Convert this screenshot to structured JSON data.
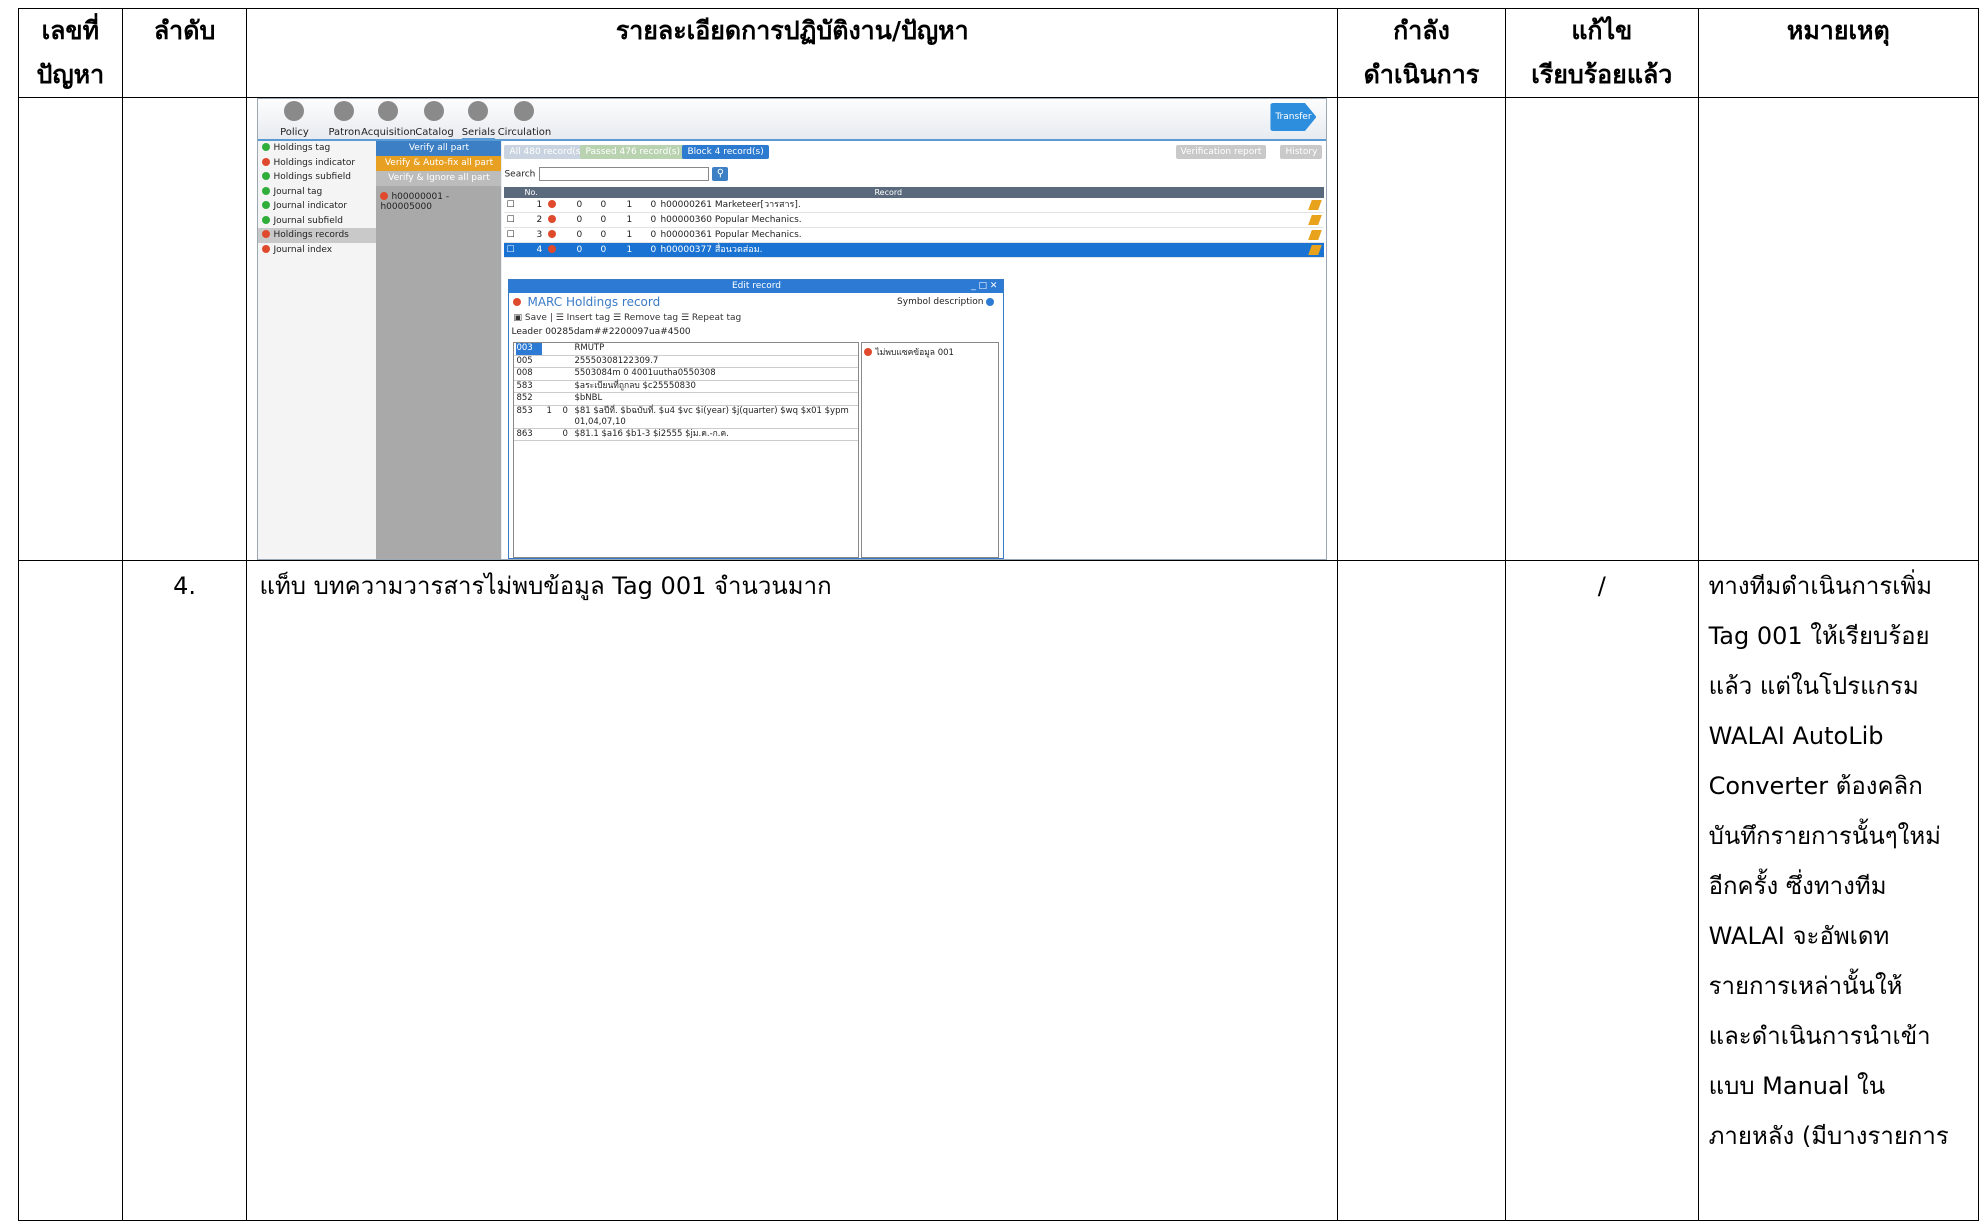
{
  "headers": {
    "issue_no": "เลขที่\nปัญหา",
    "seq": "ลำดับ",
    "detail": "รายละเอียดการปฏิบัติงาน/ปัญหา",
    "in_progress": "กำลัง\nดำเนินการ",
    "fixed": "แก้ไข\nเรียบร้อยแล้ว",
    "remark": "หมายเหตุ"
  },
  "row2": {
    "seq": "4.",
    "detail": "แท็บ บทความวารสารไม่พบข้อมูล Tag 001 จำนวนมาก",
    "fixed_mark": "/",
    "remark_lines": [
      "ทางทีมดำเนินการเพิ่ม",
      "Tag 001 ให้เรียบร้อย",
      "แล้ว แต่ในโปรแกรม",
      "WALAI AutoLib",
      "Converter ต้องคลิก",
      "บันทึกรายการนั้นๆใหม่",
      "อีกครั้ง ซึ่งทางทีม",
      "WALAI จะอัพเดท",
      "รายการเหล่านั้นให้",
      "และดำเนินการนำเข้า",
      "แบบ Manual ใน",
      "ภายหลัง (มีบางรายการ"
    ]
  },
  "screenshot": {
    "ribbon": [
      "Policy",
      "Patron",
      "Acquisition",
      "Catalog",
      "Serials",
      "Circulation"
    ],
    "active_tab": "Serials",
    "transfer": "Transfer",
    "nav": [
      {
        "label": "Holdings tag",
        "status": "ok"
      },
      {
        "label": "Holdings indicator",
        "status": "bad"
      },
      {
        "label": "Holdings subfield",
        "status": "ok"
      },
      {
        "label": "Journal tag",
        "status": "ok"
      },
      {
        "label": "Journal indicator",
        "status": "ok"
      },
      {
        "label": "Journal subfield",
        "status": "ok"
      },
      {
        "label": "Holdings records",
        "status": "bad"
      },
      {
        "label": "Journal index",
        "status": "bad"
      }
    ],
    "verify_all": "Verify all part",
    "verify_autofix": "Verify & Auto-fix all part",
    "verify_ignore": "Verify & Ignore all part",
    "range": "h00000001 - h00005000",
    "all_records": "All 480 record(s)",
    "passed": "Passed 476 record(s)",
    "block": "Block 4 record(s)",
    "verification_report": "Verification report",
    "history": "History",
    "search_label": "Search",
    "grid_header_no": "No.",
    "grid_header_record": "Record",
    "rows": [
      {
        "no": "1",
        "c1": "0",
        "c2": "0",
        "c3": "1",
        "c4": "0",
        "record": "h00000261 Marketeer[วารสาร]."
      },
      {
        "no": "2",
        "c1": "0",
        "c2": "0",
        "c3": "1",
        "c4": "0",
        "record": "h00000360 Popular Mechanics."
      },
      {
        "no": "3",
        "c1": "0",
        "c2": "0",
        "c3": "1",
        "c4": "0",
        "record": "h00000361 Popular Mechanics."
      },
      {
        "no": "4",
        "c1": "0",
        "c2": "0",
        "c3": "1",
        "c4": "0",
        "record": "h00000377 สื่อนวดส่อม."
      }
    ],
    "dialog_title": "Edit record",
    "dialog_heading": "MARC Holdings record",
    "symbol_description": "Symbol description",
    "tool_save": "Save",
    "tool_insert": "Insert tag",
    "tool_remove": "Remove tag",
    "tool_repeat": "Repeat tag",
    "leader": "Leader  00285dam##2200097ua#4500",
    "marc": [
      {
        "tag": "003",
        "i1": "",
        "i2": "",
        "val": "RMUTP"
      },
      {
        "tag": "005",
        "i1": "",
        "i2": "",
        "val": "25550308122309.7"
      },
      {
        "tag": "008",
        "i1": "",
        "i2": "",
        "val": "5503084m   0   4001uutha0550308"
      },
      {
        "tag": "583",
        "i1": "",
        "i2": "",
        "val": "$aระเบียนที่ถูกลบ $c25550830"
      },
      {
        "tag": "852",
        "i1": "",
        "i2": "",
        "val": "$bNBL"
      },
      {
        "tag": "853",
        "i1": "1",
        "i2": "0",
        "val": "$81 $aปีที่. $bฉบับที่. $u4 $vc $i(year) $j(quarter) $wq $x01 $ypm 01,04,07,10"
      },
      {
        "tag": "863",
        "i1": "",
        "i2": "0",
        "val": "$81.1  $a16  $b1-3  $i2555  $jม.ค.-ก.ค."
      }
    ],
    "error_msg": "ไม่พบแซคข้อมูล 001"
  }
}
